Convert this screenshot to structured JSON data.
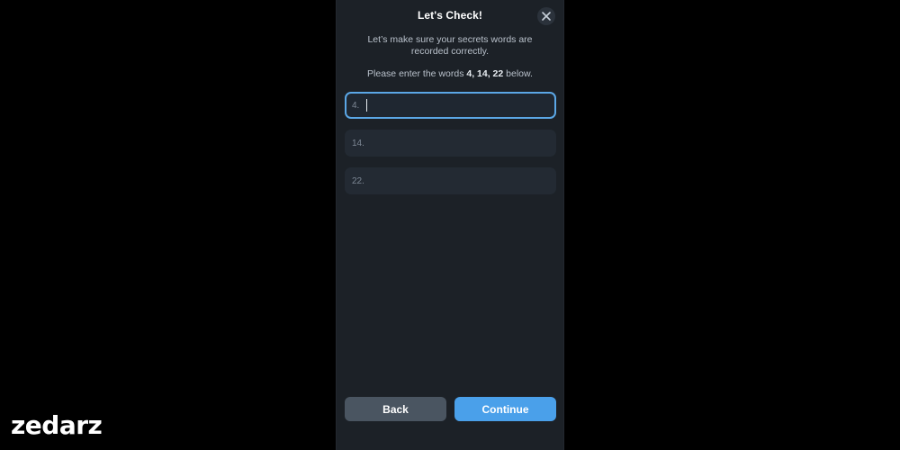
{
  "header": {
    "title": "Let's Check!",
    "close_icon": "close-icon"
  },
  "intro": {
    "line1": "Let’s make sure your secrets words are",
    "line2": "recorded correctly."
  },
  "instruction": {
    "prefix": "Please enter the words ",
    "words": "4, 14, 22",
    "suffix": " below."
  },
  "fields": [
    {
      "label": "4.",
      "value": "",
      "placeholder": ""
    },
    {
      "label": "14.",
      "value": "",
      "placeholder": ""
    },
    {
      "label": "22.",
      "value": "",
      "placeholder": ""
    }
  ],
  "buttons": {
    "back_label": "Back",
    "continue_label": "Continue"
  },
  "brand": {
    "logo_text": "zedarz"
  },
  "colors": {
    "background": "#000000",
    "panel": "#1c2127",
    "field": "#232a33",
    "focus_border": "#5ba7e6",
    "back_button": "#4a5561",
    "continue_button": "#4aa0ea",
    "text_primary": "#ffffff",
    "text_secondary": "#b9c1cb"
  }
}
